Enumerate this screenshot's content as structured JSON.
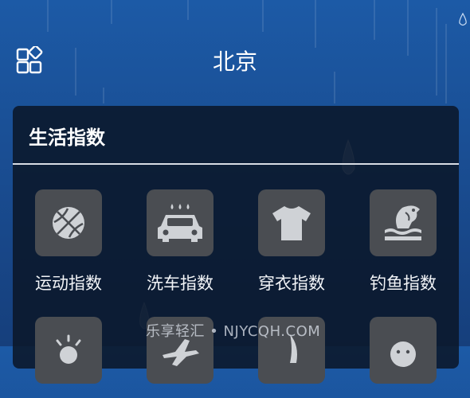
{
  "header": {
    "city": "北京",
    "menu_icon": "grid-menu-icon"
  },
  "life_index": {
    "title": "生活指数",
    "items": [
      {
        "label": "运动指数",
        "icon": "basketball-icon"
      },
      {
        "label": "洗车指数",
        "icon": "car-wash-icon"
      },
      {
        "label": "穿衣指数",
        "icon": "tshirt-icon"
      },
      {
        "label": "钓鱼指数",
        "icon": "fishing-icon"
      },
      {
        "label": "",
        "icon": "sun-icon"
      },
      {
        "label": "",
        "icon": "airplane-icon"
      },
      {
        "label": "",
        "icon": "leaf-icon"
      },
      {
        "label": "",
        "icon": "face-icon"
      }
    ]
  },
  "watermark": "乐享轻汇 • NJYCQH.COM",
  "colors": {
    "background": "#1a4f95",
    "card": "#0a1628",
    "icon_tile": "#4a4d52",
    "icon_fg": "#cfd2d6"
  }
}
